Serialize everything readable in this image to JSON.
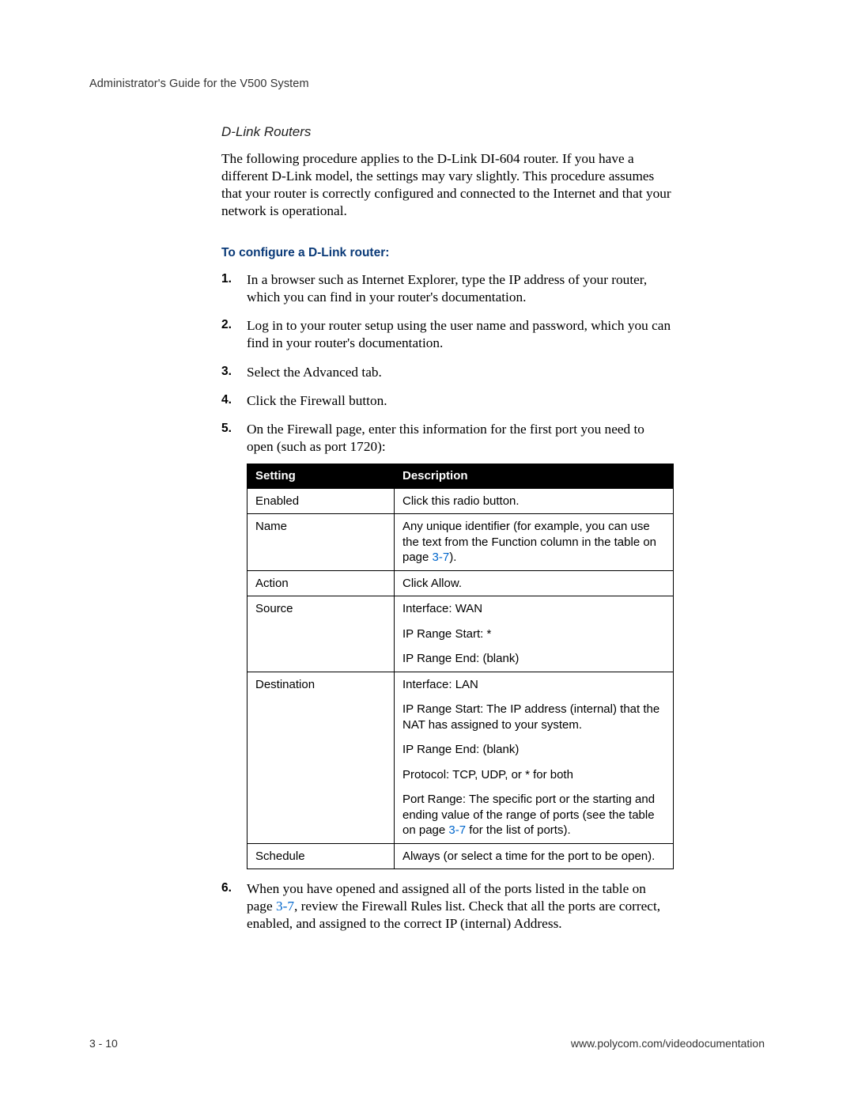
{
  "header": {
    "running": "Administrator's Guide for the V500 System"
  },
  "section": {
    "title": "D-Link Routers",
    "intro": "The following procedure applies to the D-Link DI-604 router. If you have a different D-Link model, the settings may vary slightly. This procedure assumes that your router is correctly configured and connected to the Internet and that your network is operational."
  },
  "procedure": {
    "title": "To configure a D-Link router:",
    "steps": {
      "s1": "In a browser such as Internet Explorer, type the IP address of your router, which you can find in your router's documentation.",
      "s2": "Log in to your router setup using the user name and password, which you can find in your router's documentation.",
      "s3": "Select the Advanced tab.",
      "s4": "Click the Firewall button.",
      "s5": "On the Firewall page, enter this information for the first port you need to open (such as port 1720):",
      "s6_a": "When you have opened and assigned all of the ports listed in the table on page ",
      "s6_link": "3-7",
      "s6_b": ", review the Firewall Rules list. Check that all the ports are correct, enabled, and assigned to the correct IP (internal) Address."
    }
  },
  "table": {
    "head": {
      "setting": "Setting",
      "desc": "Description"
    },
    "rows": {
      "enabled": {
        "s": "Enabled",
        "d": "Click this radio button."
      },
      "name": {
        "s": "Name",
        "d_a": "Any unique identifier (for example, you can use the text from the Function column in the table on page ",
        "d_link": "3-7",
        "d_b": ")."
      },
      "action": {
        "s": "Action",
        "d": "Click Allow."
      },
      "source": {
        "s": "Source",
        "d1": "Interface: WAN",
        "d2": "IP Range Start: *",
        "d3": "IP Range End: (blank)"
      },
      "destination": {
        "s": "Destination",
        "d1": "Interface: LAN",
        "d2": "IP Range Start: The IP address (internal) that the NAT has assigned to your system.",
        "d3": "IP Range End: (blank)",
        "d4": "Protocol: TCP, UDP, or * for both",
        "d5_a": "Port Range: The specific port or the starting and ending value of the range of ports (see the table on page ",
        "d5_link": "3-7",
        "d5_b": " for the list of ports)."
      },
      "schedule": {
        "s": "Schedule",
        "d": "Always (or select a time for the port to be open)."
      }
    }
  },
  "footer": {
    "page": "3 - 10",
    "url": "www.polycom.com/videodocumentation"
  }
}
